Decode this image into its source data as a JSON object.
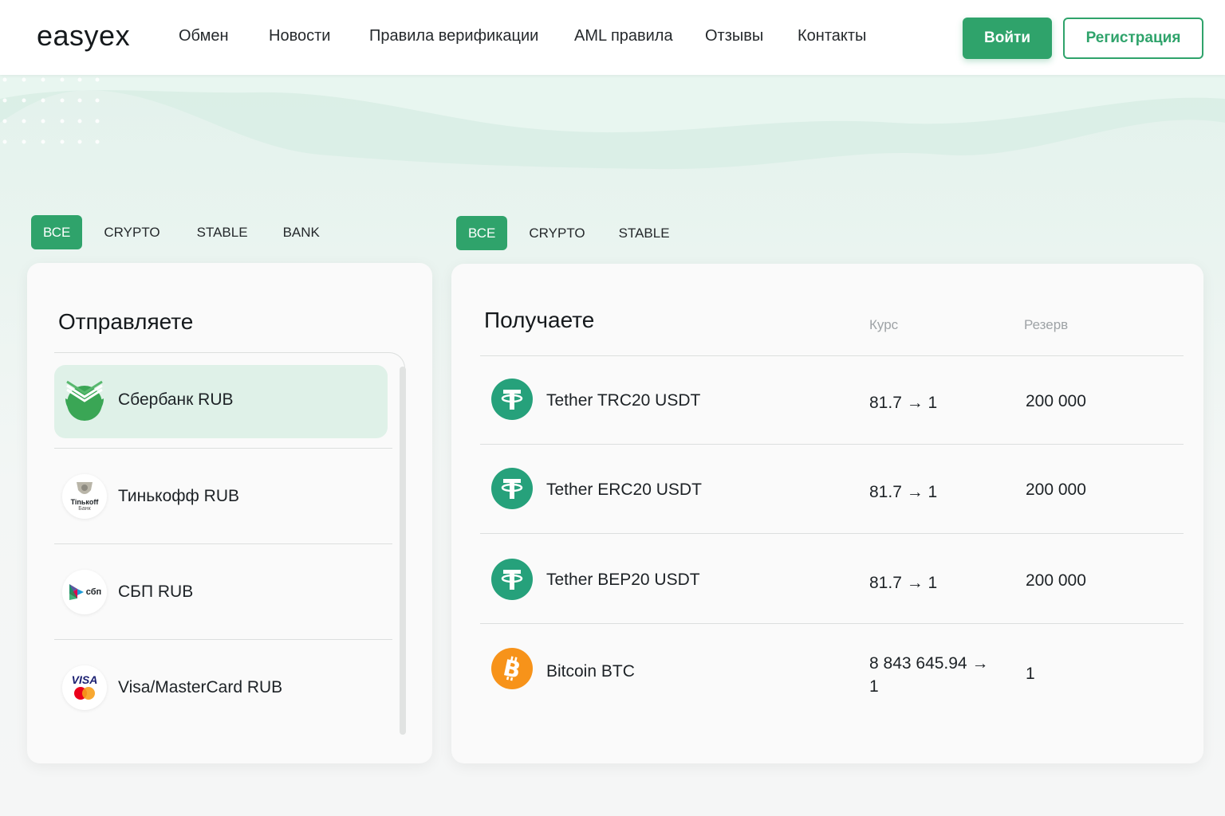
{
  "header": {
    "logo": "easyex",
    "nav": [
      "Обмен",
      "Новости",
      "Правила верификации",
      "AML правила",
      "Отзывы",
      "Контакты"
    ],
    "login_label": "Войти",
    "register_label": "Регистрация"
  },
  "send_tabs": [
    "ВСЕ",
    "CRYPTO",
    "STABLE",
    "BANK"
  ],
  "receive_tabs": [
    "ВСЕ",
    "CRYPTO",
    "STABLE"
  ],
  "send": {
    "title": "Отправляете",
    "items": [
      {
        "label": "Сбербанк RUB",
        "icon": "sberbank-icon",
        "selected": true
      },
      {
        "label": "Тинькофф RUB",
        "icon": "tinkoff-icon",
        "icon_text": "Tinькoff",
        "icon_sub": "Банк"
      },
      {
        "label": "СБП RUB",
        "icon": "sbp-icon",
        "icon_text": "сбп"
      },
      {
        "label": "Visa/MasterCard RUB",
        "icon": "visa-mastercard-icon",
        "icon_text": "VISA"
      }
    ]
  },
  "receive": {
    "title": "Получаете",
    "col_rate": "Курс",
    "col_reserve": "Резерв",
    "items": [
      {
        "name": "Tether TRC20 USDT",
        "rate": "81.7 → 1",
        "reserve": "200 000",
        "icon": "tether-icon"
      },
      {
        "name": "Tether ERC20 USDT",
        "rate": "81.7 → 1",
        "reserve": "200 000",
        "icon": "tether-icon"
      },
      {
        "name": "Tether BEP20 USDT",
        "rate": "81.7 → 1",
        "reserve": "200 000",
        "icon": "tether-icon"
      },
      {
        "name": "Bitcoin BTC",
        "rate": "8 843 645.94 → 1",
        "reserve": "1",
        "icon": "bitcoin-icon"
      }
    ]
  },
  "colors": {
    "accent": "#2fa36b",
    "tether": "#26a17b",
    "bitcoin": "#f7931a",
    "selected_row": "#dff1e8"
  }
}
